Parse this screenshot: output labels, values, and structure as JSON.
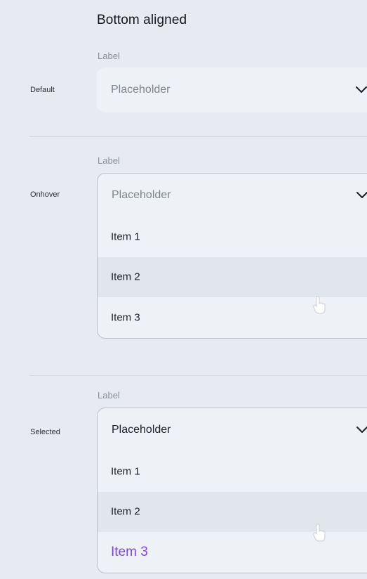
{
  "title": "Bottom aligned",
  "colors": {
    "accent": "#7a45e8",
    "background": "#e7ebf1",
    "field": "#eef2f7",
    "highlight": "#e1e5ec"
  },
  "rows": {
    "default": {
      "state": "Default",
      "label": "Label",
      "placeholder": "Placeholder"
    },
    "onhover": {
      "state": "Onhover",
      "label": "Label",
      "placeholder": "Placeholder",
      "items": [
        "Item 1",
        "Item 2",
        "Item 3"
      ],
      "hovered_item": "Item 2"
    },
    "selected": {
      "state": "Selected",
      "label": "Label",
      "placeholder": "Placeholder",
      "items": [
        "Item 1",
        "Item 2",
        "Item 3"
      ],
      "hovered_item": "Item 2",
      "selected_item": "Item 3"
    }
  }
}
